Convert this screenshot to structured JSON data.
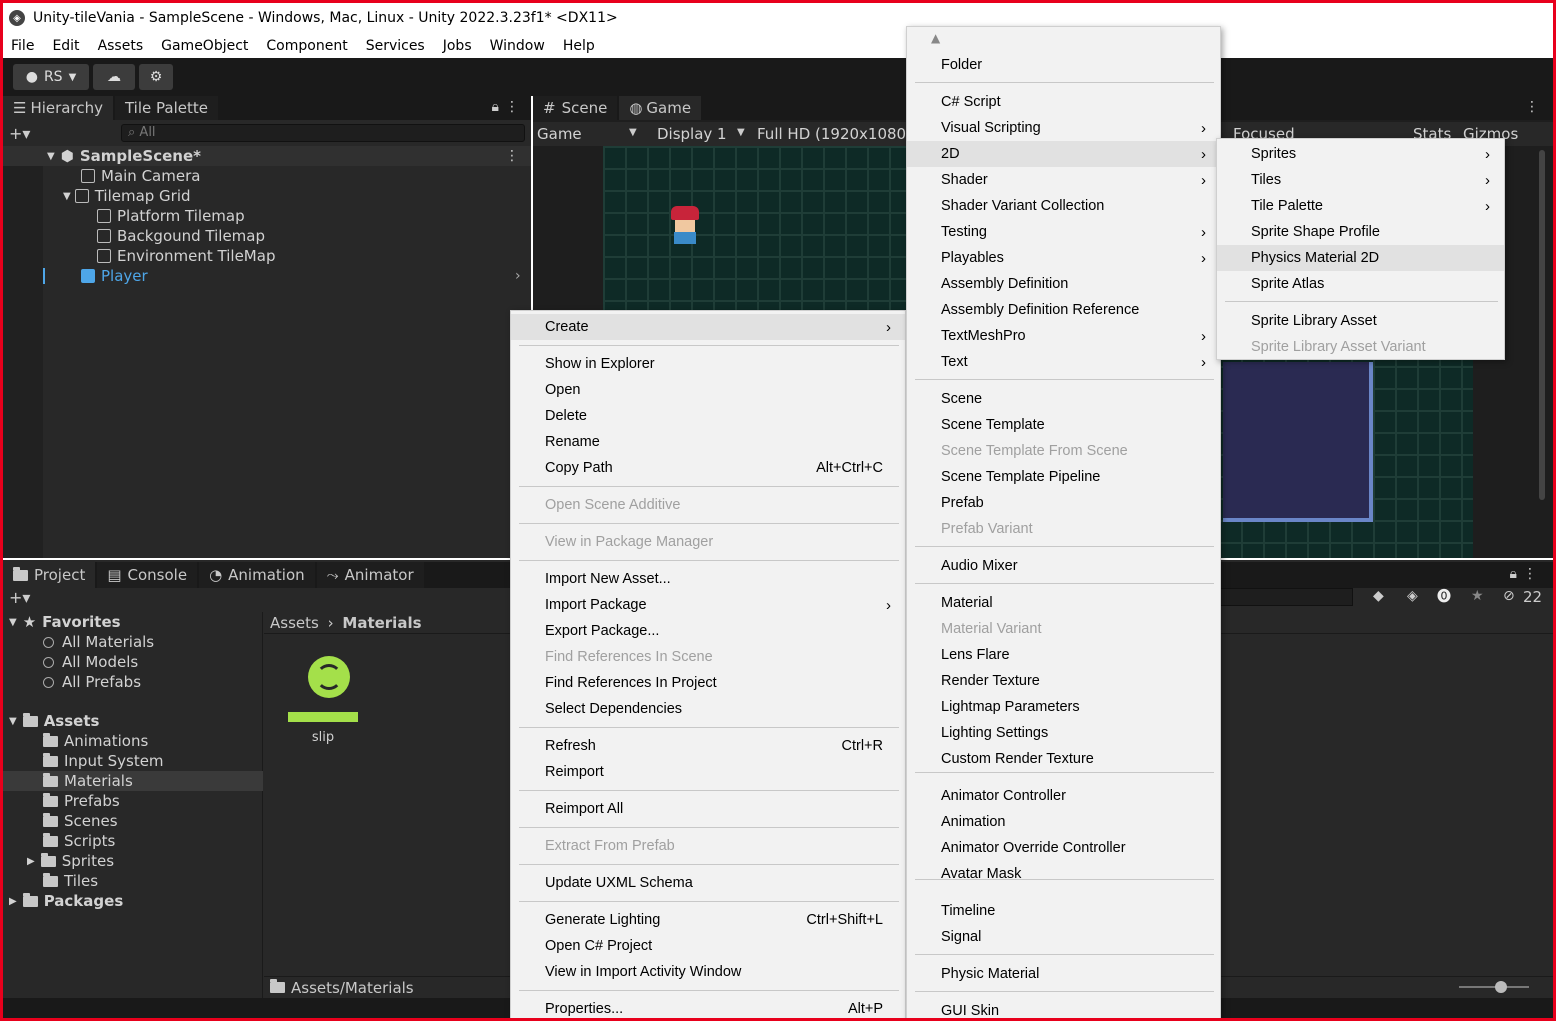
{
  "window": {
    "title": "Unity-tileVania - SampleScene - Windows, Mac, Linux - Unity 2022.3.23f1* <DX11>"
  },
  "menubar": [
    "File",
    "Edit",
    "Assets",
    "GameObject",
    "Component",
    "Services",
    "Jobs",
    "Window",
    "Help"
  ],
  "toolbar": {
    "account": "RS"
  },
  "hierarchy": {
    "tab1": "Hierarchy",
    "tab2": "Tile Palette",
    "search_placeholder": "All",
    "scene": "SampleScene*",
    "items": [
      "Main Camera",
      "Tilemap Grid",
      "Platform Tilemap",
      "Backgound Tilemap",
      "Environment TileMap",
      "Player"
    ]
  },
  "scene_view": {
    "tab_scene": "Scene",
    "tab_game": "Game",
    "game_dropdown": "Game",
    "display": "Display 1",
    "resolution": "Full HD (1920x1080)",
    "focused": "Focused",
    "stats": "Stats",
    "gizmos": "Gizmos"
  },
  "project": {
    "tabs": [
      "Project",
      "Console",
      "Animation",
      "Animator"
    ],
    "favorites": "Favorites",
    "fav_items": [
      "All Materials",
      "All Models",
      "All Prefabs"
    ],
    "assets": "Assets",
    "asset_folders": [
      "Animations",
      "Input System",
      "Materials",
      "Prefabs",
      "Scenes",
      "Scripts",
      "Sprites",
      "Tiles"
    ],
    "packages": "Packages",
    "breadcrumb_root": "Assets",
    "breadcrumb_current": "Materials",
    "asset_name": "slip",
    "footer_path": "Assets/Materials",
    "hidden_count": "22"
  },
  "context_menu": {
    "items": [
      {
        "label": "Create",
        "arrow": ">"
      },
      {
        "label": "Show in Explorer"
      },
      {
        "label": "Open"
      },
      {
        "label": "Delete"
      },
      {
        "label": "Rename"
      },
      {
        "label": "Copy Path",
        "shortcut": "Alt+Ctrl+C"
      },
      {
        "label": "Open Scene Additive"
      },
      {
        "label": "View in Package Manager"
      },
      {
        "label": "Import New Asset..."
      },
      {
        "label": "Import Package",
        "arrow": ">"
      },
      {
        "label": "Export Package..."
      },
      {
        "label": "Find References In Scene"
      },
      {
        "label": "Find References In Project"
      },
      {
        "label": "Select Dependencies"
      },
      {
        "label": "Refresh",
        "shortcut": "Ctrl+R"
      },
      {
        "label": "Reimport"
      },
      {
        "label": "Reimport All"
      },
      {
        "label": "Extract From Prefab"
      },
      {
        "label": "Update UXML Schema"
      },
      {
        "label": "Generate Lighting",
        "shortcut": "Ctrl+Shift+L"
      },
      {
        "label": "Open C# Project"
      },
      {
        "label": "View in Import Activity Window"
      },
      {
        "label": "Properties...",
        "shortcut": "Alt+P"
      }
    ]
  },
  "create_menu": {
    "items": [
      {
        "label": "Folder"
      },
      {
        "label": "C# Script"
      },
      {
        "label": "Visual Scripting",
        "arrow": ">"
      },
      {
        "label": "2D",
        "arrow": ">"
      },
      {
        "label": "Shader",
        "arrow": ">"
      },
      {
        "label": "Shader Variant Collection"
      },
      {
        "label": "Testing",
        "arrow": ">"
      },
      {
        "label": "Playables",
        "arrow": ">"
      },
      {
        "label": "Assembly Definition"
      },
      {
        "label": "Assembly Definition Reference"
      },
      {
        "label": "TextMeshPro",
        "arrow": ">"
      },
      {
        "label": "Text",
        "arrow": ">"
      },
      {
        "label": "Scene"
      },
      {
        "label": "Scene Template"
      },
      {
        "label": "Scene Template From Scene"
      },
      {
        "label": "Scene Template Pipeline"
      },
      {
        "label": "Prefab"
      },
      {
        "label": "Prefab Variant"
      },
      {
        "label": "Audio Mixer"
      },
      {
        "label": "Material"
      },
      {
        "label": "Material Variant"
      },
      {
        "label": "Lens Flare"
      },
      {
        "label": "Render Texture"
      },
      {
        "label": "Lightmap Parameters"
      },
      {
        "label": "Lighting Settings"
      },
      {
        "label": "Custom Render Texture"
      },
      {
        "label": "Animator Controller"
      },
      {
        "label": "Animation"
      },
      {
        "label": "Animator Override Controller"
      },
      {
        "label": "Avatar Mask"
      },
      {
        "label": "Timeline"
      },
      {
        "label": "Signal"
      },
      {
        "label": "Physic Material"
      },
      {
        "label": "GUI Skin"
      }
    ]
  },
  "submenu_2d": {
    "items": [
      {
        "label": "Sprites",
        "arrow": ">"
      },
      {
        "label": "Tiles",
        "arrow": ">"
      },
      {
        "label": "Tile Palette",
        "arrow": ">"
      },
      {
        "label": "Sprite Shape Profile"
      },
      {
        "label": "Physics Material 2D"
      },
      {
        "label": "Sprite Atlas"
      },
      {
        "label": "Sprite Library Asset"
      },
      {
        "label": "Sprite Library Asset Variant"
      }
    ]
  },
  "colors": {
    "frame": "#e8001c",
    "editor_bg": "#282828",
    "menu_bg": "#f2f2f2",
    "asset_icon": "#a4e04a",
    "selection": "#4ea6e8"
  }
}
